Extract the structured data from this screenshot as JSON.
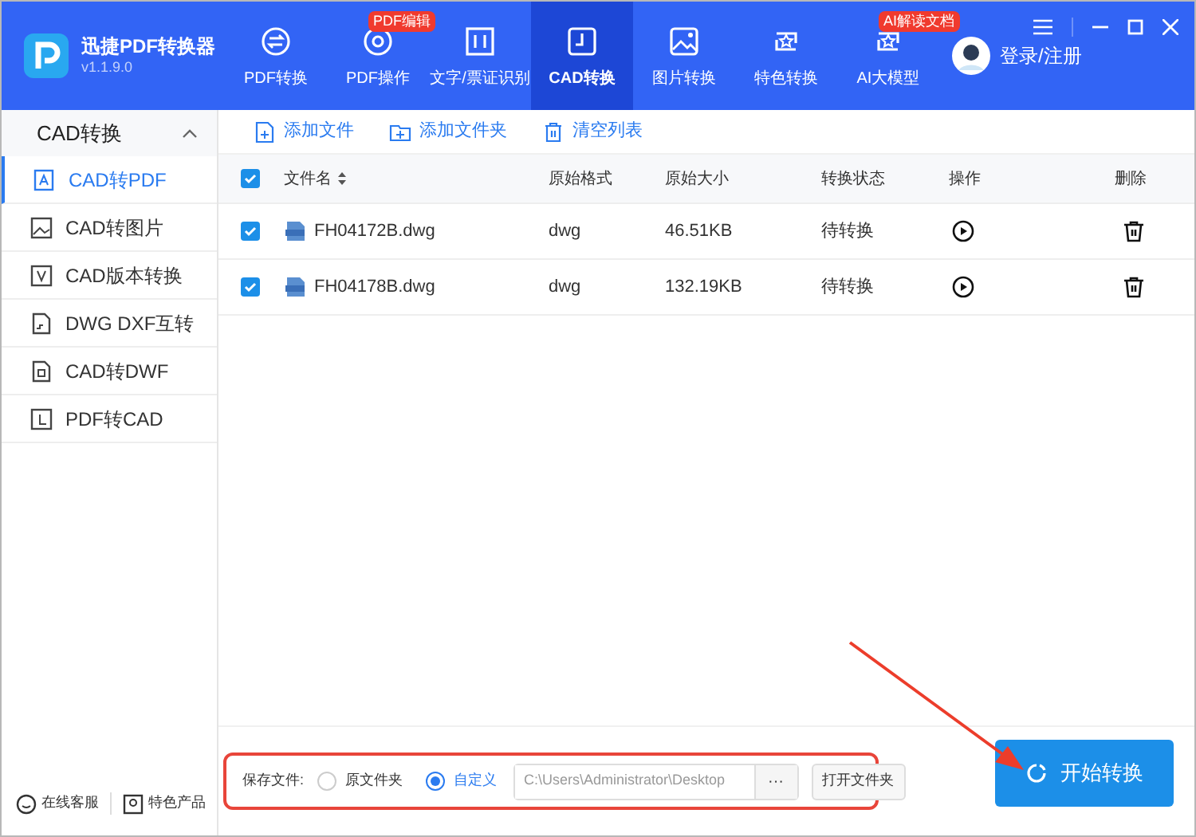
{
  "app": {
    "name": "迅捷PDF转换器",
    "version": "v1.1.9.0"
  },
  "tabs": [
    {
      "label": "PDF转换",
      "selected": false
    },
    {
      "label": "PDF操作",
      "selected": false,
      "badge": "PDF编辑"
    },
    {
      "label": "文字/票证识别",
      "selected": false
    },
    {
      "label": "CAD转换",
      "selected": true
    },
    {
      "label": "图片转换",
      "selected": false
    },
    {
      "label": "特色转换",
      "selected": false
    },
    {
      "label": "AI大模型",
      "selected": false,
      "badge": "AI解读文档"
    }
  ],
  "user": {
    "label": "登录/注册"
  },
  "sidebar": {
    "title": "CAD转换",
    "expanded": true,
    "items": [
      {
        "label": "CAD转PDF",
        "selected": true
      },
      {
        "label": "CAD转图片",
        "selected": false
      },
      {
        "label": "CAD版本转换",
        "selected": false
      },
      {
        "label": "DWG DXF互转",
        "selected": false
      },
      {
        "label": "CAD转DWF",
        "selected": false
      },
      {
        "label": "PDF转CAD",
        "selected": false
      }
    ]
  },
  "footer_links": [
    "在线客服",
    "特色产品"
  ],
  "toolbar": [
    "添加文件",
    "添加文件夹",
    "清空列表"
  ],
  "table": {
    "all_checked": true,
    "columns": [
      "文件名",
      "原始格式",
      "原始大小",
      "转换状态",
      "操作",
      "删除"
    ],
    "rows": [
      {
        "checked": true,
        "name": "FH04172B.dwg",
        "format": "dwg",
        "size": "46.51KB",
        "status": "待转换"
      },
      {
        "checked": true,
        "name": "FH04178B.dwg",
        "format": "dwg",
        "size": "132.19KB",
        "status": "待转换"
      }
    ]
  },
  "save": {
    "label": "保存文件:",
    "options": [
      {
        "label": "原文件夹",
        "selected": false
      },
      {
        "label": "自定义",
        "selected": true
      }
    ],
    "path": "C:\\Users\\Administrator\\Desktop",
    "browse": "···",
    "open_button": "打开文件夹"
  },
  "start_button": "开始转换"
}
